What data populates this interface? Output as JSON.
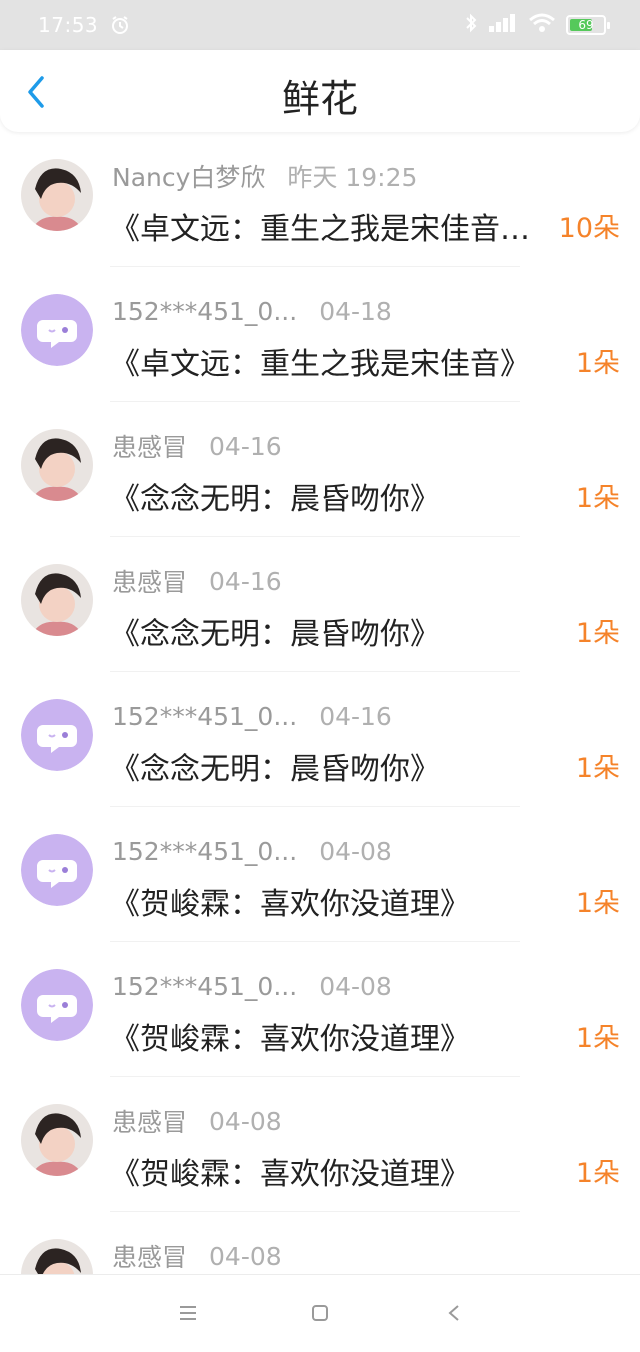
{
  "status_bar": {
    "time": "17:53",
    "battery": "69",
    "battery_level": 0.69,
    "accent_color": "#55c95b"
  },
  "header": {
    "title": "鲜花"
  },
  "items": [
    {
      "user": "Nancy白梦欣",
      "date": "昨天 19:25",
      "book": "《卓文远：重生之我是宋佳音…",
      "count": "10朵",
      "avatar": "photo"
    },
    {
      "user": "152***451_0...",
      "date": "04-18",
      "book": "《卓文远：重生之我是宋佳音》",
      "count": "1朵",
      "avatar": "default"
    },
    {
      "user": "患感冒",
      "date": "04-16",
      "book": "《念念无明：晨昏吻你》",
      "count": "1朵",
      "avatar": "photo"
    },
    {
      "user": "患感冒",
      "date": "04-16",
      "book": "《念念无明：晨昏吻你》",
      "count": "1朵",
      "avatar": "photo"
    },
    {
      "user": "152***451_0...",
      "date": "04-16",
      "book": "《念念无明：晨昏吻你》",
      "count": "1朵",
      "avatar": "default"
    },
    {
      "user": "152***451_0...",
      "date": "04-08",
      "book": "《贺峻霖：喜欢你没道理》",
      "count": "1朵",
      "avatar": "default"
    },
    {
      "user": "152***451_0...",
      "date": "04-08",
      "book": "《贺峻霖：喜欢你没道理》",
      "count": "1朵",
      "avatar": "default"
    },
    {
      "user": "患感冒",
      "date": "04-08",
      "book": "《贺峻霖：喜欢你没道理》",
      "count": "1朵",
      "avatar": "photo"
    },
    {
      "user": "患感冒",
      "date": "04-08",
      "book": "",
      "count": "",
      "avatar": "photo"
    }
  ],
  "nav": {
    "icons": [
      "menu-icon",
      "home-square-icon",
      "back-triangle-icon"
    ]
  },
  "colors": {
    "accent_orange": "#f5832a",
    "back_blue": "#1e9be9",
    "default_avatar": "#c9b3f0"
  }
}
